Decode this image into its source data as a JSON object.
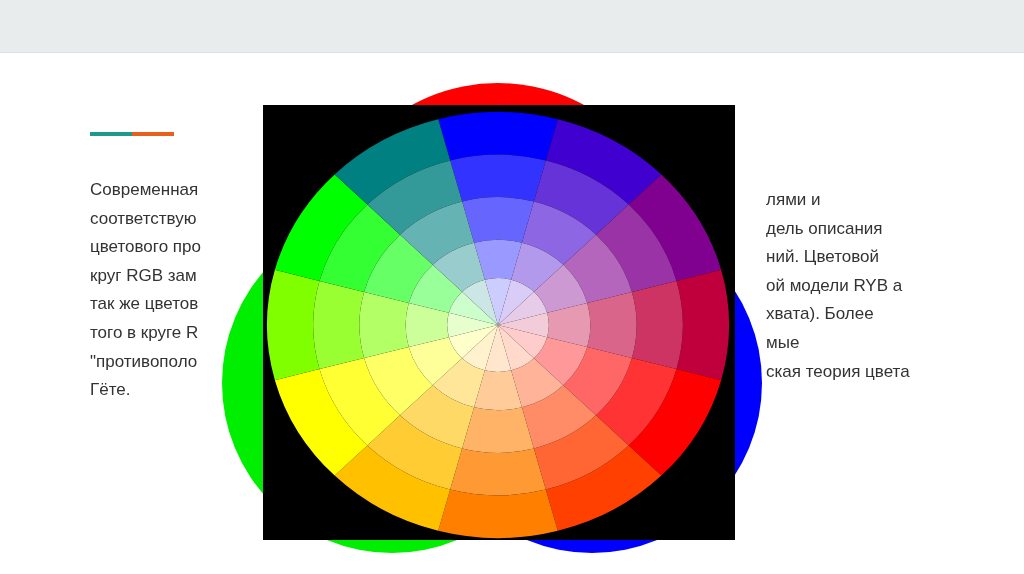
{
  "slide": {
    "text_left_lines": [
      "Современная",
      "соответствую",
      "цветового про",
      "круг RGB зам",
      "так же цветов",
      "того в круге R",
      "\"противополо",
      "Гёте."
    ],
    "text_right_lines": [
      "лями и",
      "дель описания",
      "ний. Цветовой",
      "ой модели RYB а",
      "хвата). Более",
      "мые",
      "ская теория цвета"
    ]
  }
}
